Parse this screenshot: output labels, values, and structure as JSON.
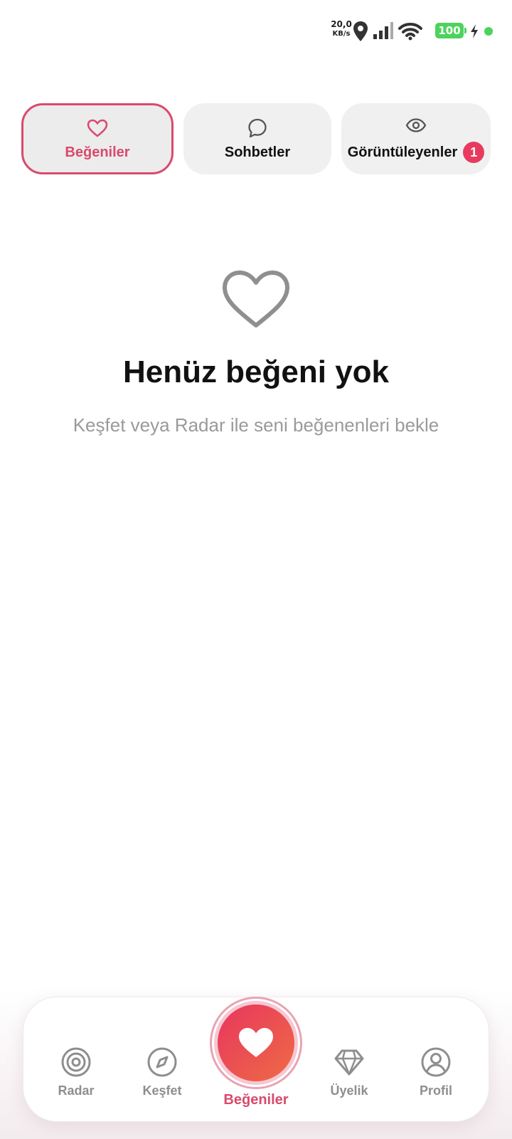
{
  "status_bar": {
    "net_speed": "20,0",
    "net_unit": "KB/s",
    "battery": "100"
  },
  "tabs": [
    {
      "label": "Beğeniler",
      "icon": "heart-icon",
      "active": true
    },
    {
      "label": "Sohbetler",
      "icon": "chat-bubble-icon",
      "active": false
    },
    {
      "label": "Görüntüleyenler",
      "icon": "eye-icon",
      "active": false,
      "badge": "1"
    }
  ],
  "empty_state": {
    "icon": "heart-outline-icon",
    "title": "Henüz beğeni yok",
    "subtitle": "Keşfet veya Radar ile seni beğenenleri bekle"
  },
  "bottom_nav": {
    "items": [
      {
        "label": "Radar",
        "icon": "radar-icon"
      },
      {
        "label": "Keşfet",
        "icon": "compass-icon"
      },
      {
        "label": "Beğeniler",
        "icon": "heart-icon",
        "active": true
      },
      {
        "label": "Üyelik",
        "icon": "diamond-icon"
      },
      {
        "label": "Profil",
        "icon": "profile-icon"
      }
    ]
  },
  "colors": {
    "accent": "#d94a6c",
    "badge": "#e83a5e",
    "gradient_start": "#e8365f",
    "gradient_end": "#ee6b44",
    "battery": "#4cd35c"
  }
}
